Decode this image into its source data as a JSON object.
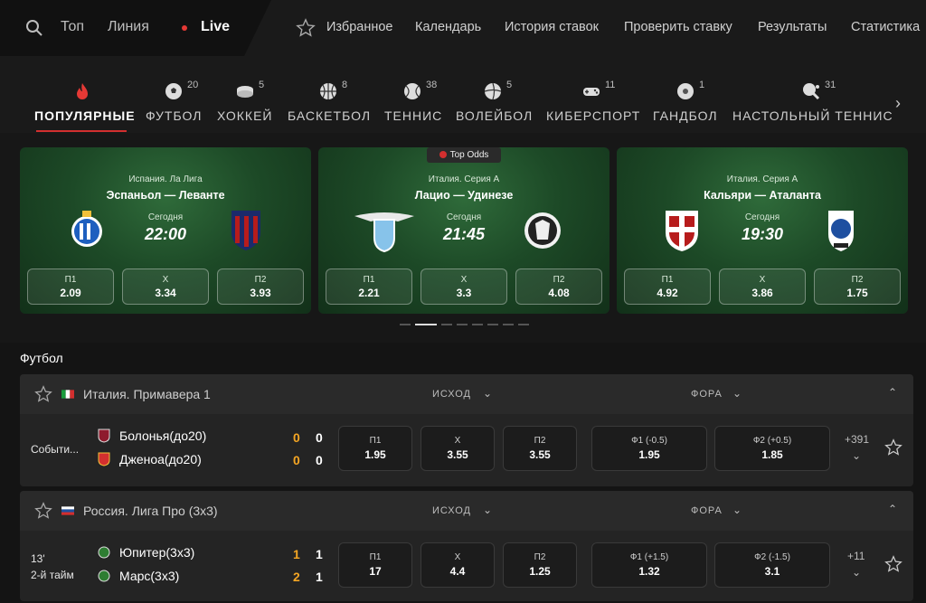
{
  "topbar": {
    "nav": [
      "Топ",
      "Линия"
    ],
    "live": "Live",
    "links": [
      "Избранное",
      "Календарь",
      "История ставок",
      "Проверить ставку",
      "Результаты",
      "Статистика"
    ]
  },
  "categories": [
    {
      "label": "ПОПУЛЯРНЫЕ",
      "count": "",
      "icon": "fire-icon"
    },
    {
      "label": "ФУТБОЛ",
      "count": "20",
      "icon": "football-icon"
    },
    {
      "label": "ХОККЕЙ",
      "count": "5",
      "icon": "hockey-puck-icon"
    },
    {
      "label": "БАСКЕТБОЛ",
      "count": "8",
      "icon": "basketball-icon"
    },
    {
      "label": "ТЕННИС",
      "count": "38",
      "icon": "tennis-ball-icon"
    },
    {
      "label": "ВОЛЕЙБОЛ",
      "count": "5",
      "icon": "volleyball-icon"
    },
    {
      "label": "КИБЕРСПОРТ",
      "count": "11",
      "icon": "gamepad-icon"
    },
    {
      "label": "ГАНДБОЛ",
      "count": "1",
      "icon": "handball-icon"
    },
    {
      "label": "НАСТОЛЬНЫЙ ТЕННИС",
      "count": "31",
      "icon": "table-tennis-icon"
    }
  ],
  "cards": [
    {
      "league": "Испания. Ла Лига",
      "teams": "Эспаньол — Леванте",
      "day": "Сегодня",
      "time": "22:00",
      "odds": [
        {
          "k": "П1",
          "v": "2.09"
        },
        {
          "k": "X",
          "v": "3.34"
        },
        {
          "k": "П2",
          "v": "3.93"
        }
      ]
    },
    {
      "league": "Италия. Серия А",
      "teams": "Лацио — Удинезе",
      "day": "Сегодня",
      "time": "21:45",
      "odds": [
        {
          "k": "П1",
          "v": "2.21"
        },
        {
          "k": "X",
          "v": "3.3"
        },
        {
          "k": "П2",
          "v": "4.08"
        }
      ]
    },
    {
      "league": "Италия. Серия А",
      "teams": "Кальяри — Аталанта",
      "day": "Сегодня",
      "time": "19:30",
      "odds": [
        {
          "k": "П1",
          "v": "4.92"
        },
        {
          "k": "X",
          "v": "3.86"
        },
        {
          "k": "П2",
          "v": "1.75"
        }
      ]
    }
  ],
  "top_odds_badge": "Top Odds",
  "section_title": "Футбол",
  "blocks": [
    {
      "league": "Италия. Примавера 1",
      "col_outcome": "ИСХОД",
      "col_handicap": "ФОРА",
      "status_line1": "Событи...",
      "status_line2": "",
      "team1": "Болонья(до20)",
      "team2": "Дженоа(до20)",
      "score1": [
        "0",
        "0"
      ],
      "score2": [
        "0",
        "0"
      ],
      "odds": [
        {
          "k": "П1",
          "v": "1.95"
        },
        {
          "k": "X",
          "v": "3.55"
        },
        {
          "k": "П2",
          "v": "3.55"
        },
        {
          "k": "Ф1 (-0.5)",
          "v": "1.95"
        },
        {
          "k": "Ф2 (+0.5)",
          "v": "1.85"
        }
      ],
      "more": "+391"
    },
    {
      "league": "Россия. Лига Про (3x3)",
      "col_outcome": "ИСХОД",
      "col_handicap": "ФОРА",
      "status_line1": "13'",
      "status_line2": "2-й тайм",
      "team1": "Юпитер(3x3)",
      "team2": "Марс(3x3)",
      "score1": [
        "1",
        "1"
      ],
      "score2": [
        "2",
        "1"
      ],
      "odds": [
        {
          "k": "П1",
          "v": "17"
        },
        {
          "k": "X",
          "v": "4.4"
        },
        {
          "k": "П2",
          "v": "1.25"
        },
        {
          "k": "Ф1 (+1.5)",
          "v": "1.32"
        },
        {
          "k": "Ф2 (-1.5)",
          "v": "3.1"
        }
      ],
      "more": "+11"
    }
  ],
  "colors": {
    "live_dot": "#e53935",
    "accent": "#d32f2f",
    "score_active": "#f5a623"
  }
}
